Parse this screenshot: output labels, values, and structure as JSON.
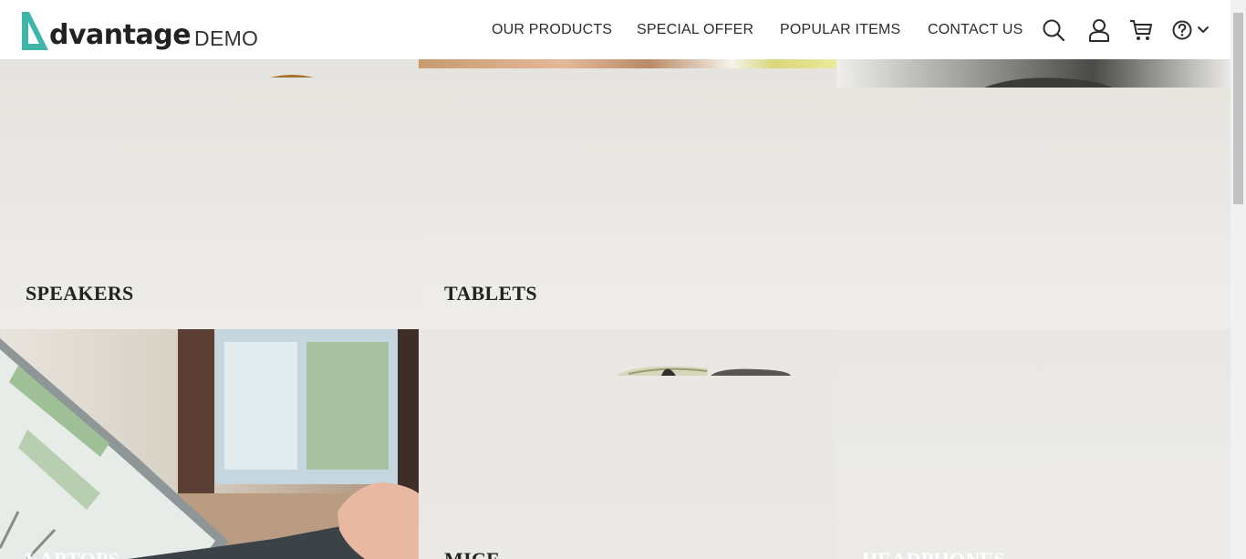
{
  "brand": {
    "name": "dvantage",
    "suffix": "DEMO",
    "accent_color": "#3fb4a8"
  },
  "nav": {
    "items": [
      {
        "label": "OUR PRODUCTS"
      },
      {
        "label": "SPECIAL OFFER"
      },
      {
        "label": "POPULAR ITEMS"
      },
      {
        "label": "CONTACT US"
      }
    ],
    "icons": [
      "search-icon",
      "user-icon",
      "cart-icon",
      "help-icon",
      "chevron-down-icon"
    ]
  },
  "categories": [
    {
      "label": "SPEAKERS"
    },
    {
      "label": "TABLETS"
    },
    {
      "label": "LAPTOPS"
    },
    {
      "label": "MICE"
    },
    {
      "label": "HEADPHONES"
    }
  ]
}
